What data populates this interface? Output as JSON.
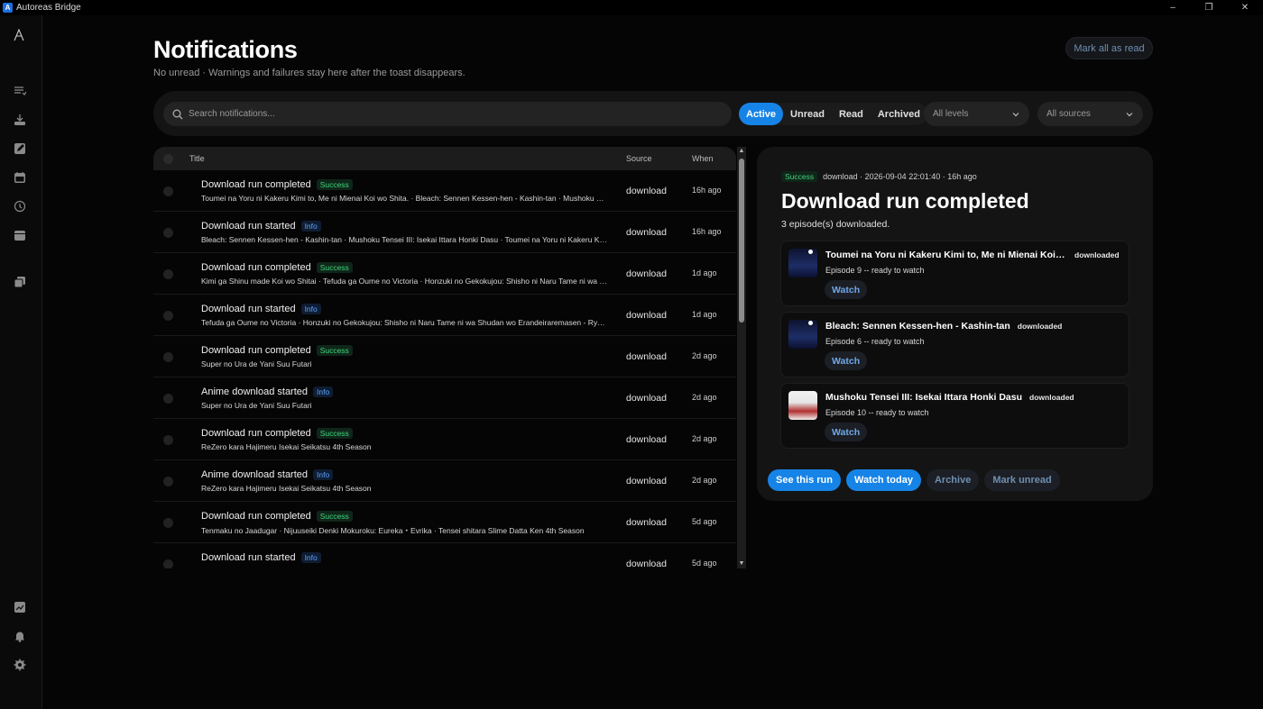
{
  "window": {
    "title": "Autoreas Bridge",
    "logo_letter": "A",
    "controls": [
      "–",
      "❐",
      "✕"
    ]
  },
  "sidebar": {
    "icons": [
      "brand-logo-icon",
      "queue-icon",
      "download-icon",
      "edit-icon",
      "calendar-icon",
      "history-icon",
      "schedule-icon",
      "library-icon",
      "stats-icon",
      "bell-icon",
      "settings-icon"
    ]
  },
  "header": {
    "title": "Notifications",
    "subtitle": "No unread · Warnings and failures stay here after the toast disappears.",
    "mark_all": "Mark all as read"
  },
  "filters": {
    "search_placeholder": "Search notifications...",
    "tabs": [
      {
        "label": "Active",
        "active": true
      },
      {
        "label": "Unread",
        "active": false
      },
      {
        "label": "Read",
        "active": false
      },
      {
        "label": "Archived",
        "active": false
      }
    ],
    "level": "All levels",
    "source": "All sources"
  },
  "table": {
    "columns": {
      "title": "Title",
      "source": "Source",
      "when": "When"
    },
    "rows": [
      {
        "title": "Download run completed",
        "badge": "Success",
        "level": "success",
        "sub": "Toumei na Yoru ni Kakeru Kimi to, Me ni Mienai Koi wo Shita. · Bleach: Sennen Kessen-hen - Kashin-tan · Mushoku Tensei III: Isekai Ittara Honki Dasu",
        "source": "download",
        "when": "16h ago"
      },
      {
        "title": "Download run started",
        "badge": "Info",
        "level": "info",
        "sub": "Bleach: Sennen Kessen-hen - Kashin-tan · Mushoku Tensei III: Isekai Ittara Honki Dasu · Toumei na Yoru ni Kakeru Kimi to, Me ni Mienai Koi wo Shita.",
        "source": "download",
        "when": "16h ago"
      },
      {
        "title": "Download run completed",
        "badge": "Success",
        "level": "success",
        "sub": "Kimi ga Shinu made Koi wo Shitai · Tefuda ga Oume no Victoria · Honzuki no Gekokujou: Shisho ni Naru Tame ni wa Shudan wo Erandeiraremasen",
        "source": "download",
        "when": "1d ago"
      },
      {
        "title": "Download run started",
        "badge": "Info",
        "level": "info",
        "sub": "Tefuda ga Oume no Victoria · Honzuki no Gekokujou: Shisho ni Naru Tame ni wa Shudan wo Erandeiraremasen - Ryoushu no Youjo",
        "source": "download",
        "when": "1d ago"
      },
      {
        "title": "Download run completed",
        "badge": "Success",
        "level": "success",
        "sub": "Super no Ura de Yani Suu Futari",
        "source": "download",
        "when": "2d ago"
      },
      {
        "title": "Anime download started",
        "badge": "Info",
        "level": "info",
        "sub": "Super no Ura de Yani Suu Futari",
        "source": "download",
        "when": "2d ago"
      },
      {
        "title": "Download run completed",
        "badge": "Success",
        "level": "success",
        "sub": "ReZero kara Hajimeru Isekai Seikatsu 4th Season",
        "source": "download",
        "when": "2d ago"
      },
      {
        "title": "Anime download started",
        "badge": "Info",
        "level": "info",
        "sub": "ReZero kara Hajimeru Isekai Seikatsu 4th Season",
        "source": "download",
        "when": "2d ago"
      },
      {
        "title": "Download run completed",
        "badge": "Success",
        "level": "success",
        "sub": "Tenmaku no Jaadugar · Nijuuseiki Denki Mokuroku: Eureka・Evrika · Tensei shitara Slime Datta Ken 4th Season",
        "source": "download",
        "when": "5d ago"
      },
      {
        "title": "Download run started",
        "badge": "Info",
        "level": "info",
        "sub": "",
        "source": "download",
        "when": "5d ago"
      }
    ]
  },
  "detail": {
    "badge": "Success",
    "meta": "download · 2026-09-04 22:01:40 · 16h ago",
    "title": "Download run completed",
    "description": "3 episode(s) downloaded.",
    "episodes": [
      {
        "title": "Toumei na Yoru ni Kakeru Kimi to, Me ni Mienai Koi wo Shita.",
        "status": "downloaded",
        "sub": "Episode 9 -- ready to watch",
        "watch": "Watch"
      },
      {
        "title": "Bleach: Sennen Kessen-hen - Kashin-tan",
        "status": "downloaded",
        "sub": "Episode 6 -- ready to watch",
        "watch": "Watch"
      },
      {
        "title": "Mushoku Tensei III: Isekai Ittara Honki Dasu",
        "status": "downloaded",
        "sub": "Episode 10 -- ready to watch",
        "watch": "Watch"
      }
    ],
    "actions": {
      "see_run": "See this run",
      "watch_today": "Watch today",
      "archive": "Archive",
      "mark_unread": "Mark unread"
    }
  },
  "colors": {
    "accent": "#1683e6",
    "success": "#3fd37a",
    "info": "#5aa2ff",
    "background": "#050505"
  }
}
